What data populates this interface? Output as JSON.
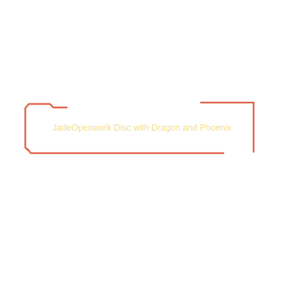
{
  "title": {
    "text": "JadeOpenwork Disc with Dragon and Phoenix"
  },
  "colors": {
    "frame": "#e0644a",
    "title": "#f3dc8a",
    "background": "#ffffff"
  }
}
